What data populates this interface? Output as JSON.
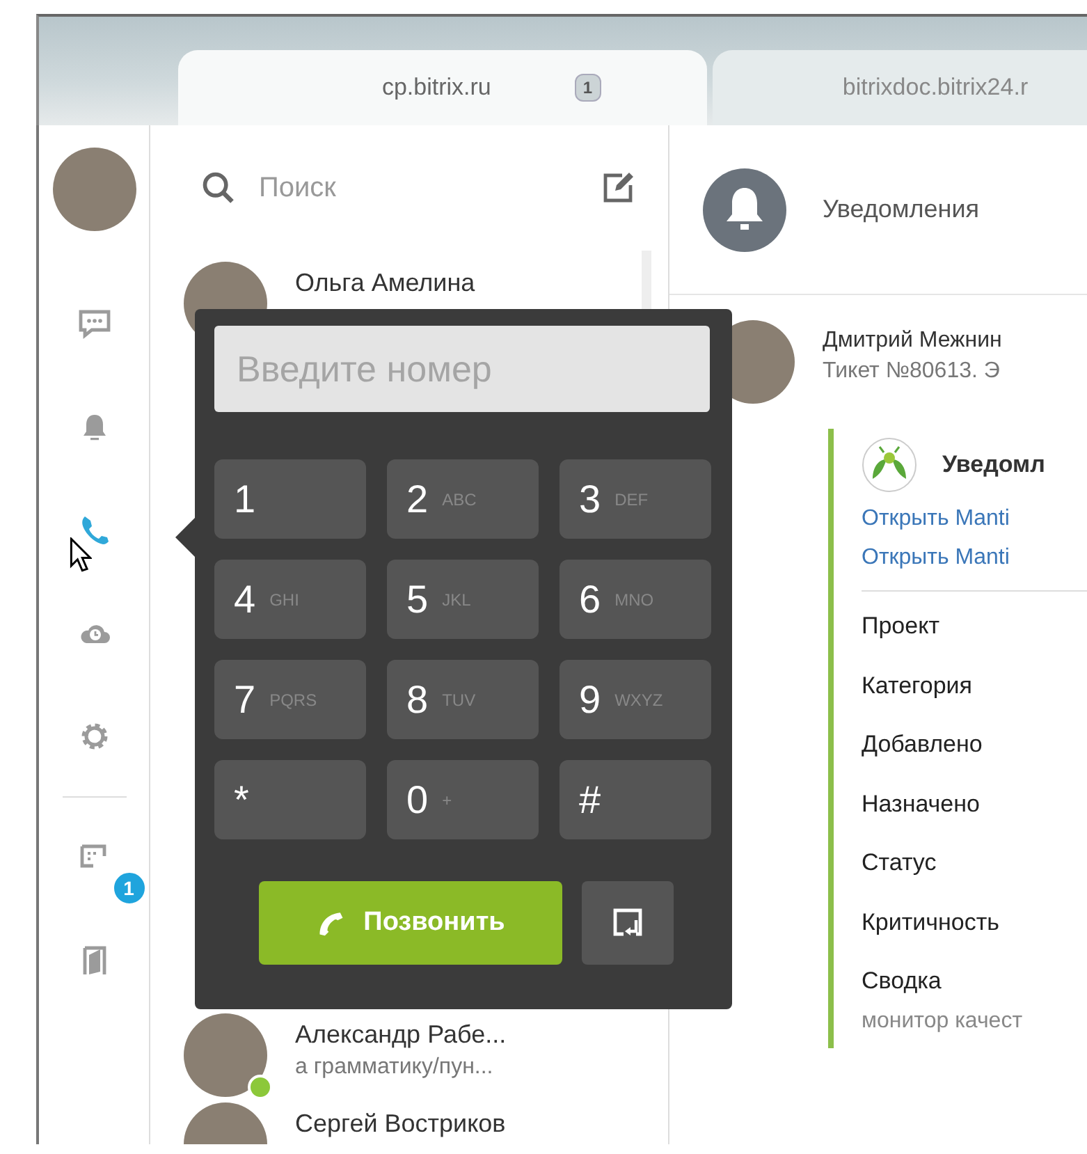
{
  "tabs": [
    {
      "label": "cp.bitrix.ru",
      "badge": "1",
      "selected": true
    },
    {
      "label": "bitrixdoc.bitrix24.r",
      "selected": false
    }
  ],
  "sidebar": {
    "items": [
      {
        "kind": "chat",
        "selected": false
      },
      {
        "kind": "bell",
        "selected": false
      },
      {
        "kind": "phone",
        "selected": true
      },
      {
        "kind": "cloud",
        "selected": false
      },
      {
        "kind": "gear",
        "selected": false
      },
      {
        "kind": "divider"
      },
      {
        "kind": "notes",
        "selected": false,
        "badge": "1"
      },
      {
        "kind": "door",
        "selected": false
      }
    ]
  },
  "contacts": {
    "search": {
      "placeholder": "Поиск"
    },
    "above_dialpad": [
      {
        "name": "Ольга Амелина"
      }
    ],
    "below_dialpad": [
      {
        "name": "Александр Рабе...",
        "message": "а грамматику/пун...",
        "online": true
      },
      {
        "name": "Сергей Востриков"
      }
    ]
  },
  "dialpad": {
    "field": {
      "placeholder": "Введите номер"
    },
    "keys": [
      {
        "digit": "1"
      },
      {
        "digit": "2",
        "letters": "ABC"
      },
      {
        "digit": "3",
        "letters": "DEF"
      },
      {
        "digit": "4",
        "letters": "GHI"
      },
      {
        "digit": "5",
        "letters": "JKL"
      },
      {
        "digit": "6",
        "letters": "MNO"
      },
      {
        "digit": "7",
        "letters": "PQRS"
      },
      {
        "digit": "8",
        "letters": "TUV"
      },
      {
        "digit": "9",
        "letters": "WXYZ"
      },
      {
        "digit": "*"
      },
      {
        "digit": "0",
        "letters": "+"
      },
      {
        "digit": "#"
      }
    ],
    "call_button": "Позвонить"
  },
  "notifications": {
    "title": "Уведомления",
    "items": [
      {
        "author": "Дмитрий Межнин",
        "text": "Тикет №80613. Э",
        "attachment": {
          "title": "Уведомл",
          "links": [
            "Открыть Manti",
            "Открыть Manti"
          ],
          "fields": [
            "Проект",
            "Категория",
            "Добавлено",
            "Назначено",
            "Статус",
            "Критичность",
            "Сводка"
          ],
          "summary": "монитор качест"
        }
      }
    ]
  }
}
